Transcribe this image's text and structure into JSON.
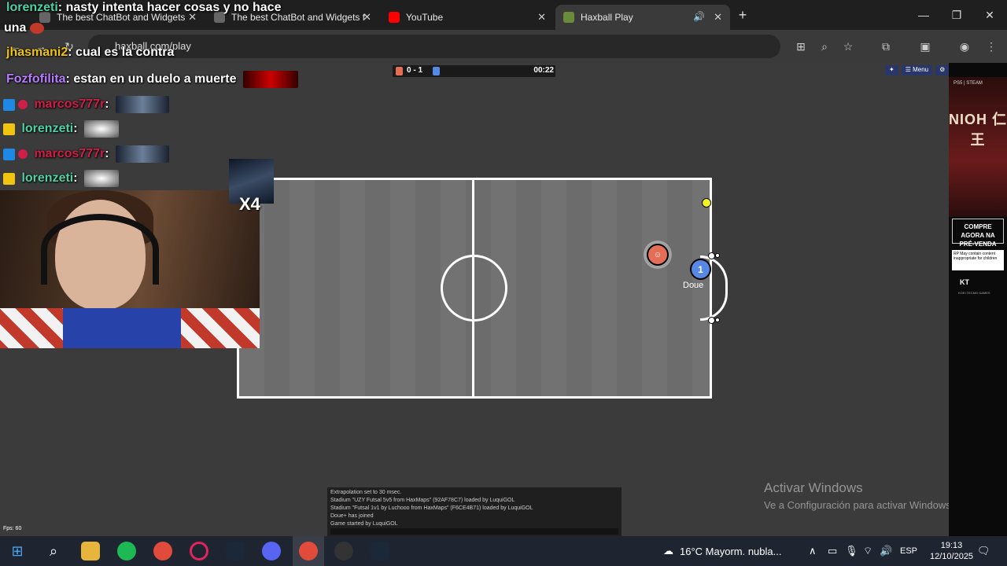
{
  "browser": {
    "tabs": [
      {
        "title": "The best ChatBot and Widgets",
        "close": "✕"
      },
      {
        "title": "The best ChatBot and Widgets f",
        "close": "✕"
      },
      {
        "title": "YouTube",
        "close": "✕"
      },
      {
        "title": "Haxball Play",
        "close": "✕"
      }
    ],
    "new_tab": "+",
    "url": "haxball.com/play",
    "window_controls": {
      "minimize": "—",
      "maximize": "❐",
      "close": "✕"
    }
  },
  "game": {
    "score": "0 - 1",
    "time": "00:22",
    "player_number": "1",
    "player_name": "Doue",
    "menu_buttons": [
      "✦",
      "☰ Menu",
      "⚙"
    ],
    "fps": "Fps: 60",
    "chat_log": [
      "Extrapolation set to 30 msec.",
      "Stadium \"UZY Futsal 5v5 from HaxMaps\" (92AF78C7) loaded by LuquiGOL",
      "Stadium \"Futsal 1v1 by Luchooo from HaxMaps\" (F6CE4B71) loaded by LuquiGOL",
      "Doue+ has joined",
      "Game started by LuquiGOL"
    ],
    "colors": {
      "red": "#e56e56",
      "blue": "#5689e5",
      "ball": "#f3f31e"
    }
  },
  "stream_chat": [
    {
      "user": "lorenzeti",
      "color": "#4fd1a8",
      "text": ": nasty intenta hacer cosas y no hace"
    },
    {
      "user": "",
      "color": "#ffffff",
      "text": "una"
    },
    {
      "user": "jhasmani2",
      "color": "#f1c40f",
      "text": ": cual es la contra"
    },
    {
      "user": "Fozfofilita",
      "color": "#b57cff",
      "text": ": estan en un duelo a muerte"
    },
    {
      "user": "marcos777r",
      "color": "#d11e48",
      "text": ":"
    },
    {
      "user": "lorenzeti",
      "color": "#4fd1a8",
      "text": ":"
    },
    {
      "user": "marcos777r",
      "color": "#d11e48",
      "text": ":"
    },
    {
      "user": "lorenzeti",
      "color": "#4fd1a8",
      "text": ":"
    }
  ],
  "overlay": {
    "multiplier": "X4"
  },
  "ad": {
    "brand": "PS5 | STEAM",
    "logo": "NIOH 仁王",
    "cta": "COMPRE AGORA NA PRÉ-VENDA",
    "rating": "RP May contain content inappropriate for children",
    "publisher": "KT",
    "publisher_sub": "KOEI TECMO GAMES"
  },
  "watermark": {
    "title": "Activar Windows",
    "subtitle": "Ve a Configuración para activar Windows."
  },
  "taskbar": {
    "weather": "16°C  Mayorm. nubla...",
    "lang": "ESP",
    "time": "19:13",
    "date": "12/10/2025"
  }
}
